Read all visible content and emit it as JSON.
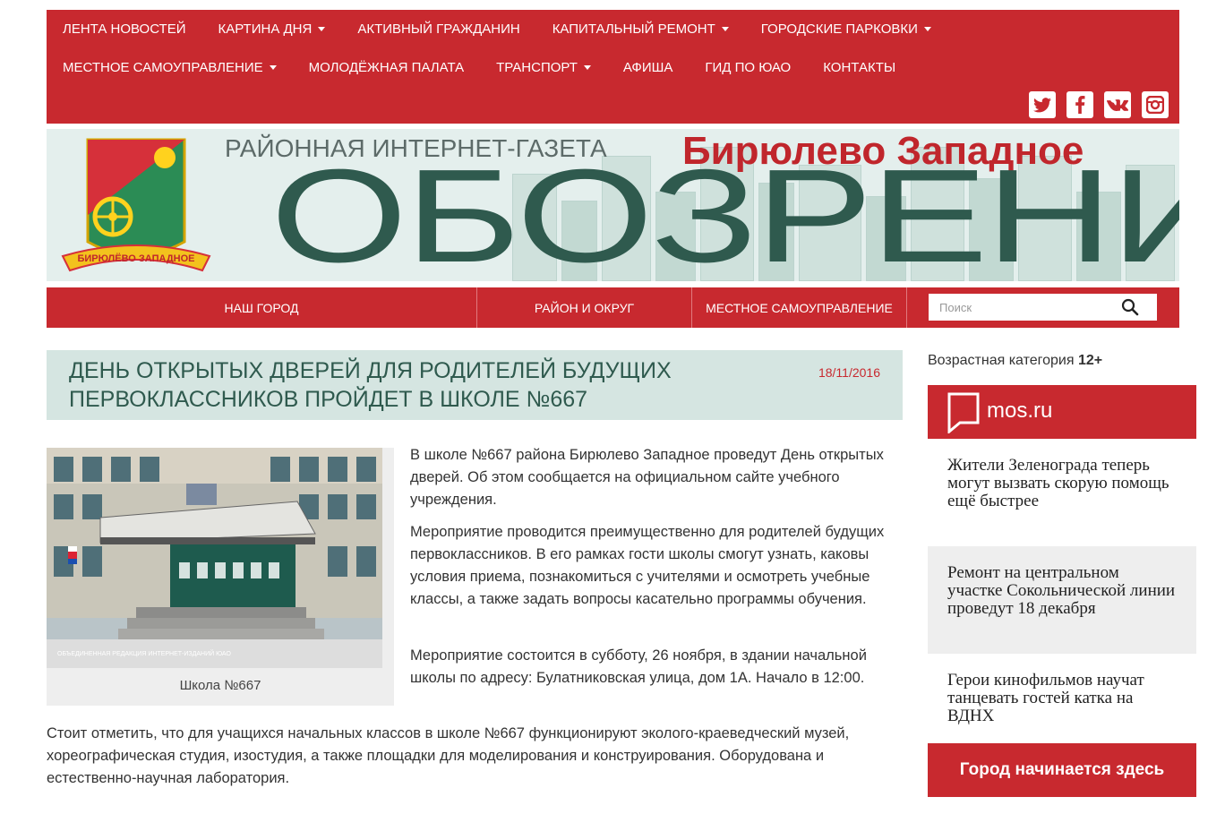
{
  "topnav": {
    "row1": [
      {
        "label": "ЛЕНТА НОВОСТЕЙ",
        "dropdown": false
      },
      {
        "label": "КАРТИНА ДНЯ",
        "dropdown": true
      },
      {
        "label": "АКТИВНЫЙ ГРАЖДАНИН",
        "dropdown": false
      },
      {
        "label": "КАПИТАЛЬНЫЙ РЕМОНТ",
        "dropdown": true
      },
      {
        "label": "ГОРОДСКИЕ ПАРКОВКИ",
        "dropdown": true
      }
    ],
    "row2": [
      {
        "label": "МЕСТНОЕ САМОУПРАВЛЕНИЕ",
        "dropdown": true
      },
      {
        "label": "МОЛОДЁЖНАЯ ПАЛАТА",
        "dropdown": false
      },
      {
        "label": "ТРАНСПОРТ",
        "dropdown": true
      },
      {
        "label": "АФИША",
        "dropdown": false
      },
      {
        "label": "ГИД ПО ЮАО",
        "dropdown": false
      },
      {
        "label": "КОНТАКТЫ",
        "dropdown": false
      }
    ],
    "socials": [
      "twitter-icon",
      "facebook-icon",
      "vk-icon",
      "instagram-icon"
    ]
  },
  "banner": {
    "subtitle": "РАЙОННАЯ ИНТЕРНЕТ-ГАЗЕТА",
    "district": "Бирюлево Западное",
    "masthead": "ОБОЗРЕНИЕ",
    "crest_ribbon": "БИРЮЛЁВО ЗАПАДНОЕ"
  },
  "subnav": {
    "items": [
      "НАШ ГОРОД",
      "РАЙОН И ОКРУГ",
      "МЕСТНОЕ САМОУПРАВЛЕНИЕ"
    ],
    "search_placeholder": "Поиск"
  },
  "article": {
    "title": "ДЕНЬ ОТКРЫТЫХ ДВЕРЕЙ ДЛЯ РОДИТЕЛЕЙ БУДУЩИХ ПЕРВОКЛАССНИКОВ ПРОЙДЕТ В ШКОЛЕ №667",
    "date": "18/11/2016",
    "image_caption": "Школа №667",
    "watermark": "ОБЪЕДИНЕННАЯ РЕДАКЦИЯ ИНТЕРНЕТ-ИЗДАНИЙ ЮАО",
    "p1": "В школе №667 района Бирюлево Западное проведут День открытых дверей. Об этом сообщается на официальном сайте учебного учреждения.",
    "p2": "Мероприятие проводится преимущественно для родителей будущих первоклассников. В его рамках  гости школы смогут узнать, каковы условия приема, познакомиться с учителями и осмотреть учебные классы, а также  задать вопросы касательно программы обучения.",
    "p3": "Мероприятие состоится в субботу, 26 ноября, в здании начальной школы по адресу: Булатниковская улица, дом 1А. Начало в 12:00.",
    "p4": "Стоит отметить, что для учащихся начальных классов в школе №667 функционируют эколого-краеведческий музей, хореографическая студия, изостудия, а также площадки для моделирования и конструирования. Оборудована и естественно-научная лаборатория."
  },
  "sidebar": {
    "age_label": "Возрастная категория",
    "age_value": "12+",
    "mos_label": "mos.ru",
    "news": [
      "Жители Зеленограда теперь могут вызвать скорую помощь ещё быстрее",
      "Ремонт на центральном участке Сокольнической линии проведут 18 декабря",
      "Герои кинофильмов научат танцевать гостей катка на ВДНХ"
    ],
    "cta": "Город начинается здесь"
  },
  "colors": {
    "brand_red": "#c8292f",
    "title_green": "#2f5a4e",
    "header_bg": "#d5e5e1"
  }
}
